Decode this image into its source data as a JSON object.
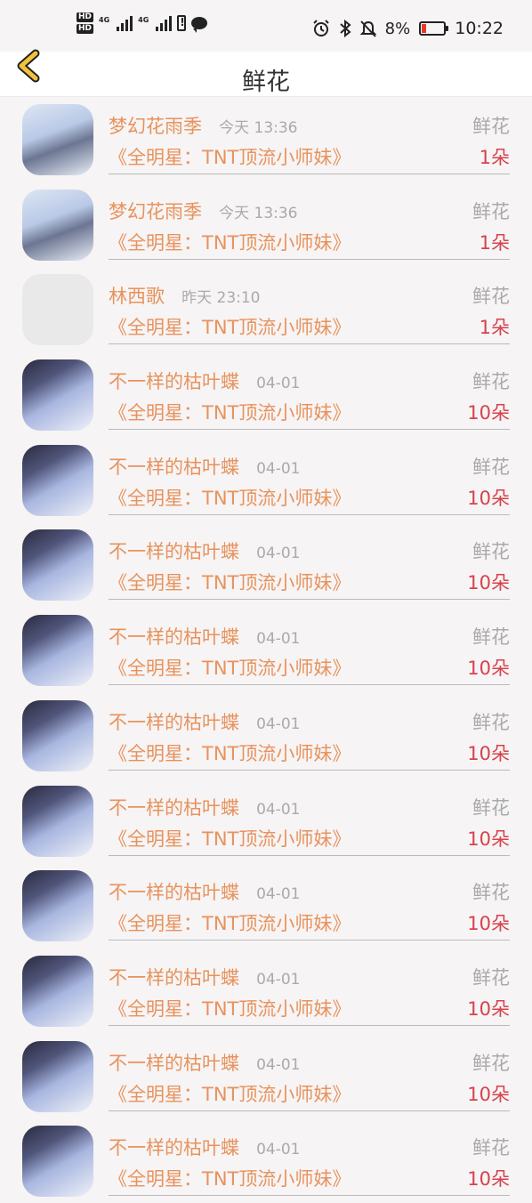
{
  "status_bar": {
    "hd1": "HD",
    "hd2": "HD",
    "net1": "4G",
    "net2": "4G",
    "battery_pct": "8%",
    "time": "10:22"
  },
  "header": {
    "title": "鲜花"
  },
  "records": [
    {
      "user": "梦幻花雨季",
      "time": "今天 13:36",
      "kind": "鲜花",
      "book": "《全明星：TNT顶流小师妹》",
      "count": "1朵",
      "avatar": "a1"
    },
    {
      "user": "梦幻花雨季",
      "time": "今天 13:36",
      "kind": "鲜花",
      "book": "《全明星：TNT顶流小师妹》",
      "count": "1朵",
      "avatar": "a1"
    },
    {
      "user": "林西歌",
      "time": "昨天 23:10",
      "kind": "鲜花",
      "book": "《全明星：TNT顶流小师妹》",
      "count": "1朵",
      "avatar": "a2"
    },
    {
      "user": "不一样的枯叶蝶",
      "time": "04-01",
      "kind": "鲜花",
      "book": "《全明星：TNT顶流小师妹》",
      "count": "10朵",
      "avatar": "a3"
    },
    {
      "user": "不一样的枯叶蝶",
      "time": "04-01",
      "kind": "鲜花",
      "book": "《全明星：TNT顶流小师妹》",
      "count": "10朵",
      "avatar": "a3"
    },
    {
      "user": "不一样的枯叶蝶",
      "time": "04-01",
      "kind": "鲜花",
      "book": "《全明星：TNT顶流小师妹》",
      "count": "10朵",
      "avatar": "a3"
    },
    {
      "user": "不一样的枯叶蝶",
      "time": "04-01",
      "kind": "鲜花",
      "book": "《全明星：TNT顶流小师妹》",
      "count": "10朵",
      "avatar": "a3"
    },
    {
      "user": "不一样的枯叶蝶",
      "time": "04-01",
      "kind": "鲜花",
      "book": "《全明星：TNT顶流小师妹》",
      "count": "10朵",
      "avatar": "a3"
    },
    {
      "user": "不一样的枯叶蝶",
      "time": "04-01",
      "kind": "鲜花",
      "book": "《全明星：TNT顶流小师妹》",
      "count": "10朵",
      "avatar": "a3"
    },
    {
      "user": "不一样的枯叶蝶",
      "time": "04-01",
      "kind": "鲜花",
      "book": "《全明星：TNT顶流小师妹》",
      "count": "10朵",
      "avatar": "a3"
    },
    {
      "user": "不一样的枯叶蝶",
      "time": "04-01",
      "kind": "鲜花",
      "book": "《全明星：TNT顶流小师妹》",
      "count": "10朵",
      "avatar": "a3"
    },
    {
      "user": "不一样的枯叶蝶",
      "time": "04-01",
      "kind": "鲜花",
      "book": "《全明星：TNT顶流小师妹》",
      "count": "10朵",
      "avatar": "a3"
    },
    {
      "user": "不一样的枯叶蝶",
      "time": "04-01",
      "kind": "鲜花",
      "book": "《全明星：TNT顶流小师妹》",
      "count": "10朵",
      "avatar": "a3"
    }
  ]
}
